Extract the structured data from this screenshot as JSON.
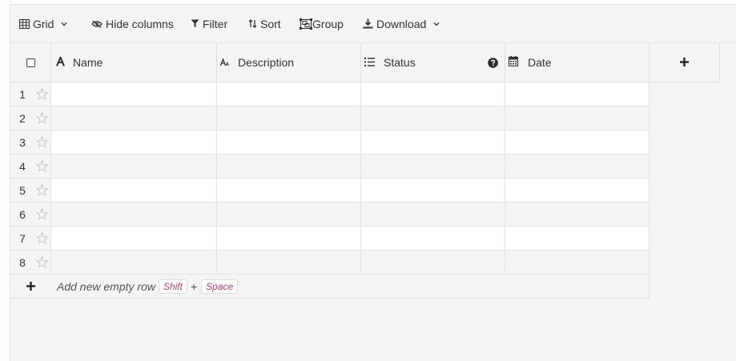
{
  "toolbar": {
    "grid_label": "Grid",
    "hide_columns_label": "Hide columns",
    "filter_label": "Filter",
    "sort_label": "Sort",
    "group_label": "Group",
    "download_label": "Download"
  },
  "columns": {
    "name": "Name",
    "description": "Description",
    "status": "Status",
    "date": "Date"
  },
  "rows": [
    "1",
    "2",
    "3",
    "4",
    "5",
    "6",
    "7",
    "8"
  ],
  "add_row": {
    "label": "Add new empty row",
    "shortcut_key1": "Shift",
    "shortcut_plus": "+",
    "shortcut_key2": "Space"
  },
  "colors": {
    "background": "#f4f4f4",
    "row_alt": "#ffffff",
    "shortcut_text": "#c0396b"
  }
}
